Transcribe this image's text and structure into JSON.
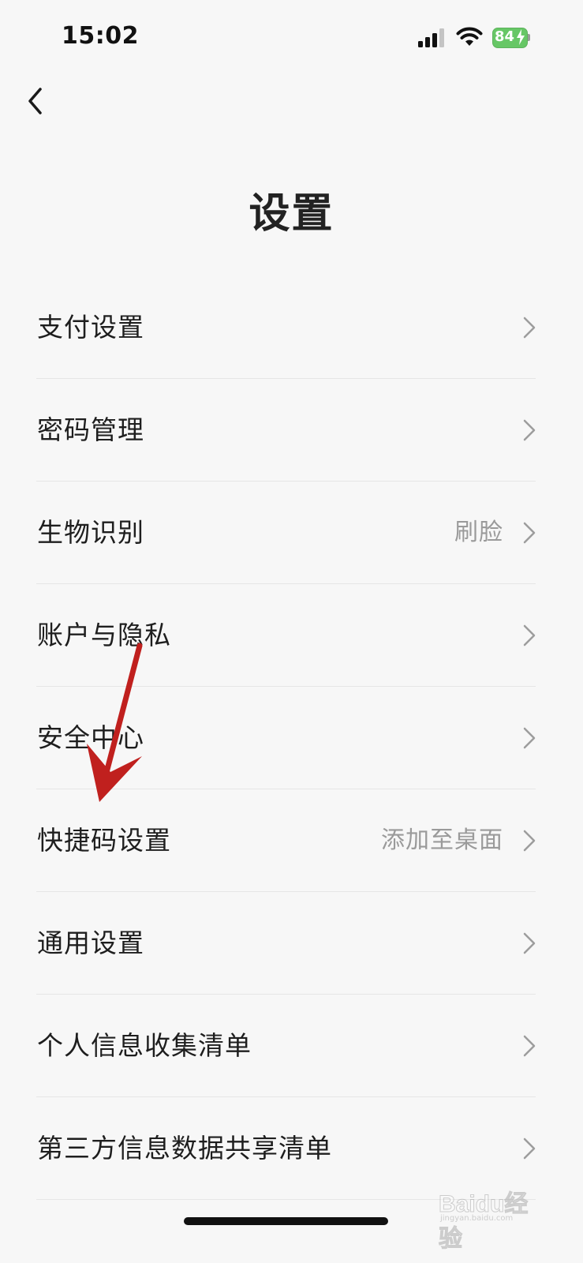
{
  "status_bar": {
    "time": "15:02",
    "battery": "84",
    "icons": [
      "signal-icon",
      "wifi-icon",
      "battery-icon",
      "charging-bolt-icon"
    ]
  },
  "nav": {
    "back_icon": "chevron-left-icon"
  },
  "page": {
    "title": "设置"
  },
  "menu": {
    "items": [
      {
        "label": "支付设置",
        "value": ""
      },
      {
        "label": "密码管理",
        "value": ""
      },
      {
        "label": "生物识别",
        "value": "刷脸"
      },
      {
        "label": "账户与隐私",
        "value": ""
      },
      {
        "label": "安全中心",
        "value": ""
      },
      {
        "label": "快捷码设置",
        "value": "添加至桌面"
      },
      {
        "label": "通用设置",
        "value": ""
      },
      {
        "label": "个人信息收集清单",
        "value": ""
      },
      {
        "label": "第三方信息数据共享清单",
        "value": ""
      }
    ],
    "chevron_icon": "chevron-right-icon"
  },
  "annotation": {
    "arrow_color": "#c0201e"
  },
  "watermark": {
    "text": "Baidu经验",
    "sub": "jingyan.baidu.com"
  },
  "colors": {
    "background": "#f7f7f7",
    "battery_green": "#67c766",
    "secondary_text": "#9a9a9a",
    "divider": "#e6e6e6"
  }
}
